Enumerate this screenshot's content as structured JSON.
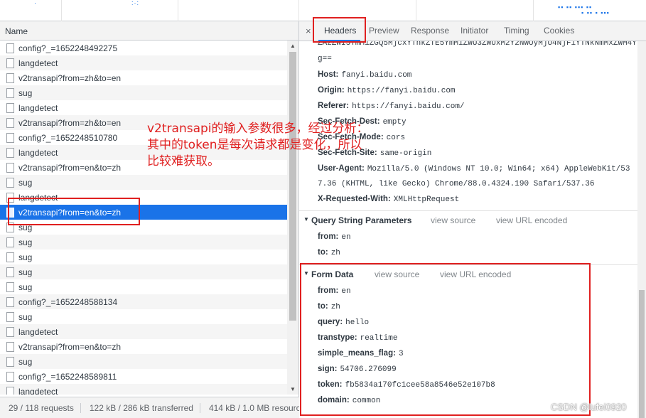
{
  "list": {
    "column_header": "Name",
    "rows": [
      "config?_=1652248492275",
      "langdetect",
      "v2transapi?from=zh&to=en",
      "sug",
      "langdetect",
      "v2transapi?from=zh&to=en",
      "config?_=1652248510780",
      "langdetect",
      "v2transapi?from=en&to=zh",
      "sug",
      "langdetect",
      "v2transapi?from=en&to=zh",
      "sug",
      "sug",
      "sug",
      "sug",
      "sug",
      "config?_=1652248588134",
      "sug",
      "langdetect",
      "v2transapi?from=en&to=zh",
      "sug",
      "config?_=1652248589811",
      "langdetect"
    ],
    "selected_index": 11
  },
  "status": {
    "requests": "29 / 118 requests",
    "transferred": "122 kB / 286 kB transferred",
    "resources": "414 kB / 1.0 MB resource"
  },
  "tabs": {
    "close": "×",
    "headers": "Headers",
    "preview": "Preview",
    "response": "Response",
    "initiator": "Initiator",
    "timing": "Timing",
    "cookies": "Cookies"
  },
  "request_headers": {
    "cookie_tail_1": "ZA2ZWI5YmM1ZGQ5MjcxYThkZTE5YmM1ZWU3ZWUxM2Y2NWUyMjU4NjFiYTNkNmMxZWM4Y",
    "cookie_tail_2": "g==",
    "host_k": "Host:",
    "host_v": "fanyi.baidu.com",
    "origin_k": "Origin:",
    "origin_v": "https://fanyi.baidu.com",
    "referer_k": "Referer:",
    "referer_v": "https://fanyi.baidu.com/",
    "sfd_k": "Sec-Fetch-Dest:",
    "sfd_v": "empty",
    "sfm_k": "Sec-Fetch-Mode:",
    "sfm_v": "cors",
    "sfs_k": "Sec-Fetch-Site:",
    "sfs_v": "same-origin",
    "ua_k": "User-Agent:",
    "ua_v": "Mozilla/5.0 (Windows NT 10.0; Win64; x64) AppleWebKit/53",
    "ua_v2": "7.36 (KHTML, like Gecko) Chrome/88.0.4324.190 Safari/537.36",
    "xrw_k": "X-Requested-With:",
    "xrw_v": "XMLHttpRequest"
  },
  "query_string": {
    "title": "Query String Parameters",
    "view_source": "view source",
    "view_url_encoded": "view URL encoded",
    "from_k": "from:",
    "from_v": "en",
    "to_k": "to:",
    "to_v": "zh"
  },
  "form_data": {
    "title": "Form Data",
    "view_source": "view source",
    "view_url_encoded": "view URL encoded",
    "from_k": "from:",
    "from_v": "en",
    "to_k": "to:",
    "to_v": "zh",
    "query_k": "query:",
    "query_v": "hello",
    "transtype_k": "transtype:",
    "transtype_v": "realtime",
    "smf_k": "simple_means_flag:",
    "smf_v": "3",
    "sign_k": "sign:",
    "sign_v": "54706.276099",
    "token_k": "token:",
    "token_v": "fb5834a170fc1cee58a8546e52e107b8",
    "domain_k": "domain:",
    "domain_v": "common"
  },
  "annotation": {
    "line1": "v2transapi的输入参数很多，经过分析：",
    "line2": "其中的token是每次请求都是变化，所以",
    "line3": "比较难获取。"
  },
  "watermark": "CSDN @lufei0920",
  "colors": {
    "accent": "#1a73e8",
    "annotation": "#e02020"
  }
}
